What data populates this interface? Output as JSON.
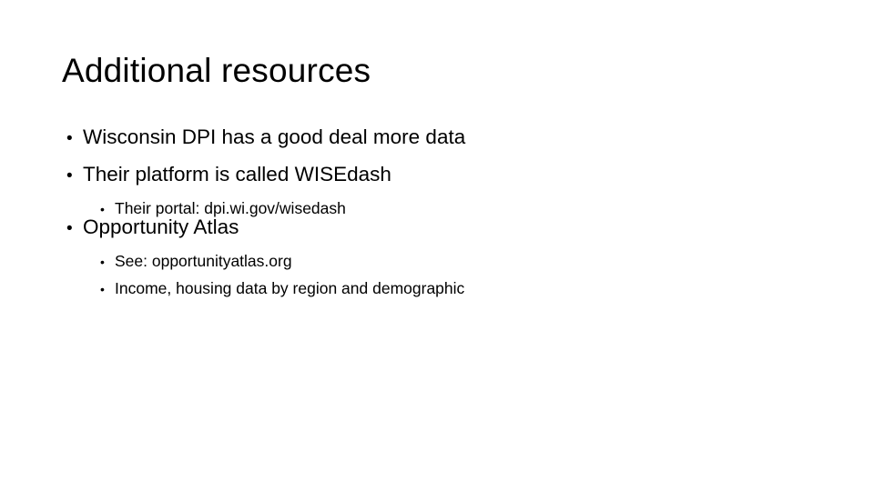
{
  "slide": {
    "title": "Additional resources",
    "background_color": "#ffffff",
    "text_color": "#000000",
    "bullet_glyph": "•",
    "groups": [
      {
        "level1": {
          "marker": "•",
          "text": "Wisconsin DPI has a good deal more data"
        },
        "children": []
      },
      {
        "level1": {
          "marker": "•",
          "text": "Their platform is called WISEdash"
        },
        "children": [
          {
            "marker": "•",
            "text": "Their portal: dpi.wi.gov/wisedash"
          }
        ]
      },
      {
        "level1": {
          "marker": "•",
          "text": "Opportunity Atlas"
        },
        "children": [
          {
            "marker": "•",
            "text": "See: opportunityatlas.org"
          },
          {
            "marker": "•",
            "text": "Income, housing data by region and demographic"
          }
        ]
      }
    ]
  }
}
